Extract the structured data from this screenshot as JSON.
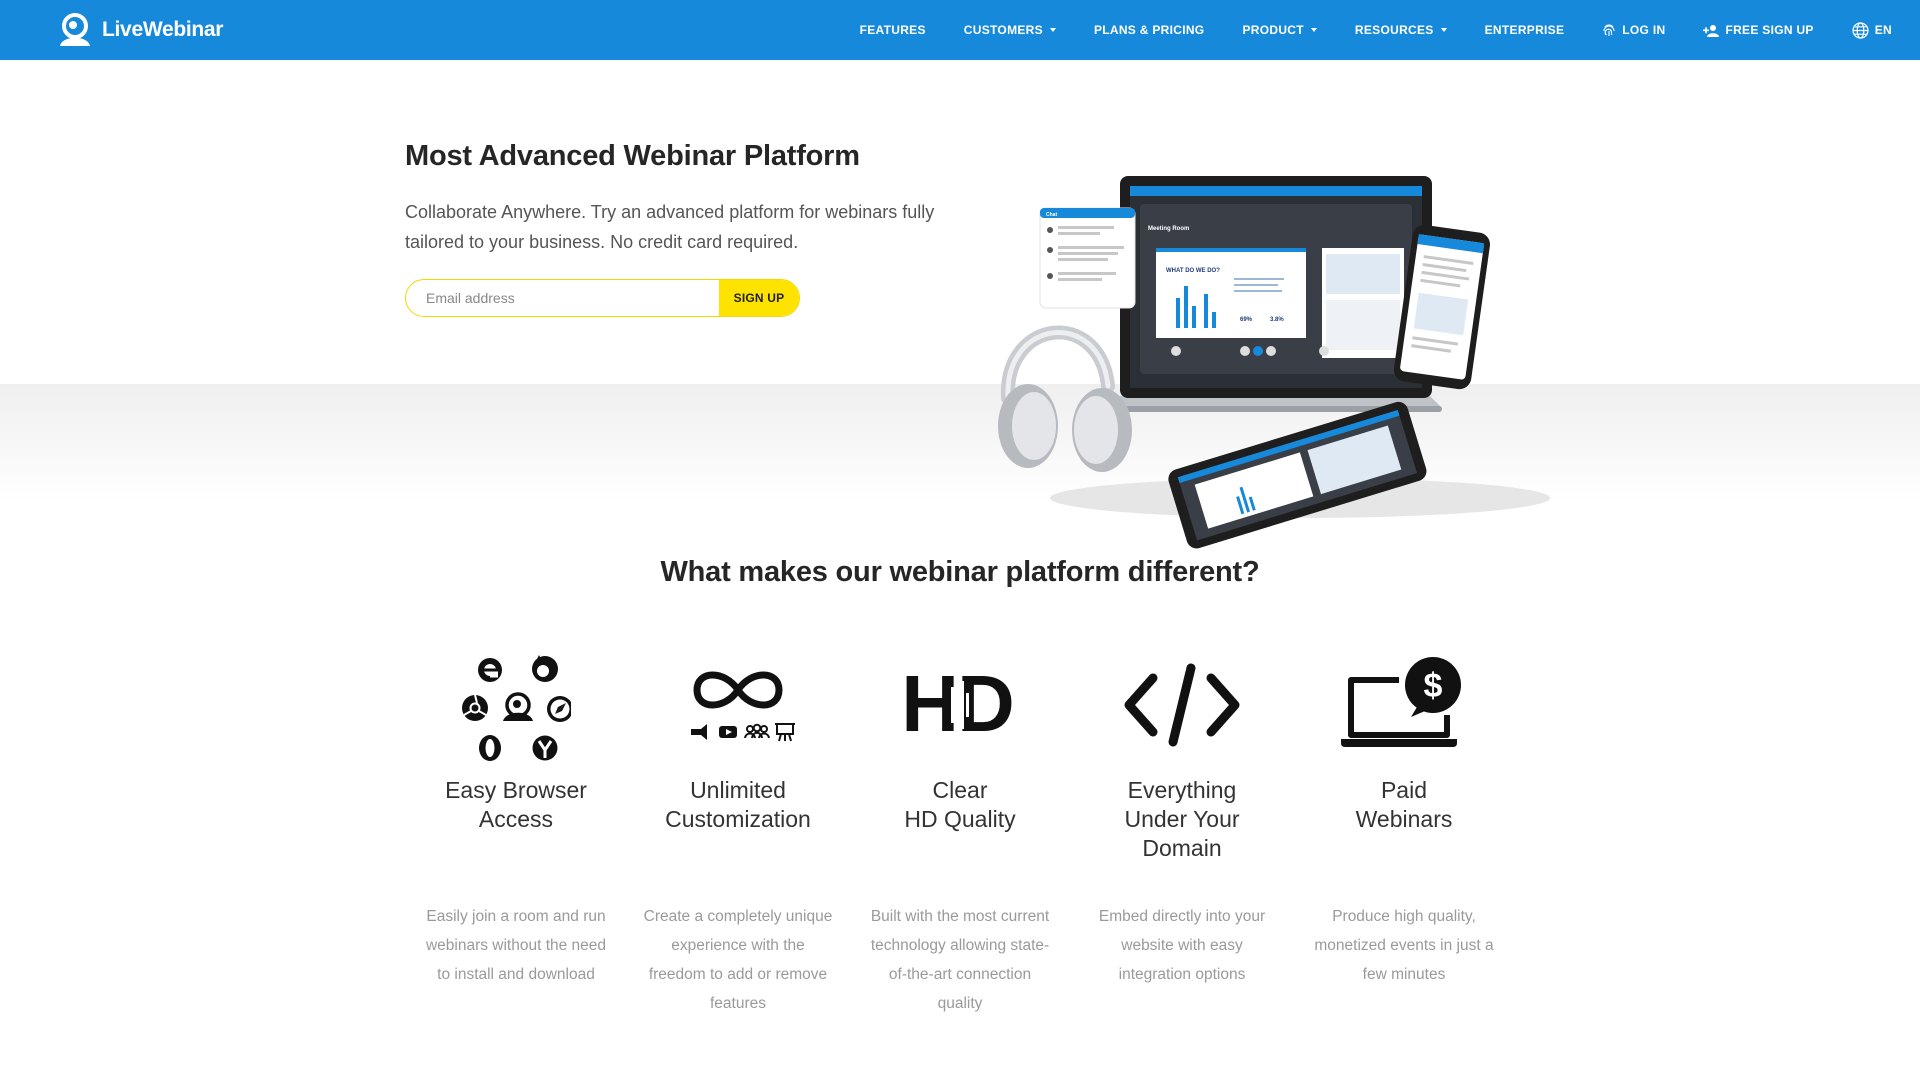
{
  "brand": {
    "name": "LiveWebinar",
    "color": "#1789db",
    "accent": "#ffe300"
  },
  "nav": {
    "items": [
      {
        "label": "FEATURES",
        "dropdown": false
      },
      {
        "label": "CUSTOMERS",
        "dropdown": true
      },
      {
        "label": "PLANS & PRICING",
        "dropdown": false
      },
      {
        "label": "PRODUCT",
        "dropdown": true
      },
      {
        "label": "RESOURCES",
        "dropdown": true
      },
      {
        "label": "ENTERPRISE",
        "dropdown": false
      }
    ],
    "login": {
      "label": "LOG IN",
      "icon": "fingerprint-icon"
    },
    "signup": {
      "label": "FREE SIGN UP",
      "icon": "add-user-icon"
    },
    "language": {
      "label": "EN",
      "icon": "globe-icon"
    }
  },
  "hero": {
    "title": "Most Advanced Webinar Platform",
    "subtitle": "Collaborate Anywhere. Try an advanced platform for webinars fully tailored to your business. No credit card required.",
    "email_placeholder": "Email address",
    "signup_label": "SIGN UP"
  },
  "devices": {
    "chat_title": "Chat",
    "room_title": "Meeting Room",
    "slide_title": "WHAT DO WE DO?",
    "stat_1": "69%",
    "stat_2": "3.8%"
  },
  "features": {
    "title": "What makes our webinar platform different?",
    "items": [
      {
        "icon": "browsers-icon",
        "title": "Easy Browser\nAccess",
        "desc": "Easily join a room and run webinars without the need to install and download"
      },
      {
        "icon": "infinity-icon",
        "title": "Unlimited\nCustomization",
        "desc": "Create a completely unique experience with the freedom to add or remove features"
      },
      {
        "icon": "hd-icon",
        "title": "Clear\nHD Quality",
        "icon_text": "HD",
        "desc": "Built with the most current technology allowing state-of-the-art connection quality"
      },
      {
        "icon": "code-icon",
        "title": "Everything\nUnder Your\nDomain",
        "desc": "Embed directly into your website with easy integration options"
      },
      {
        "icon": "paid-laptop-icon",
        "title": "Paid\nWebinars",
        "desc": "Produce high quality, monetized events in just a few minutes"
      }
    ]
  }
}
